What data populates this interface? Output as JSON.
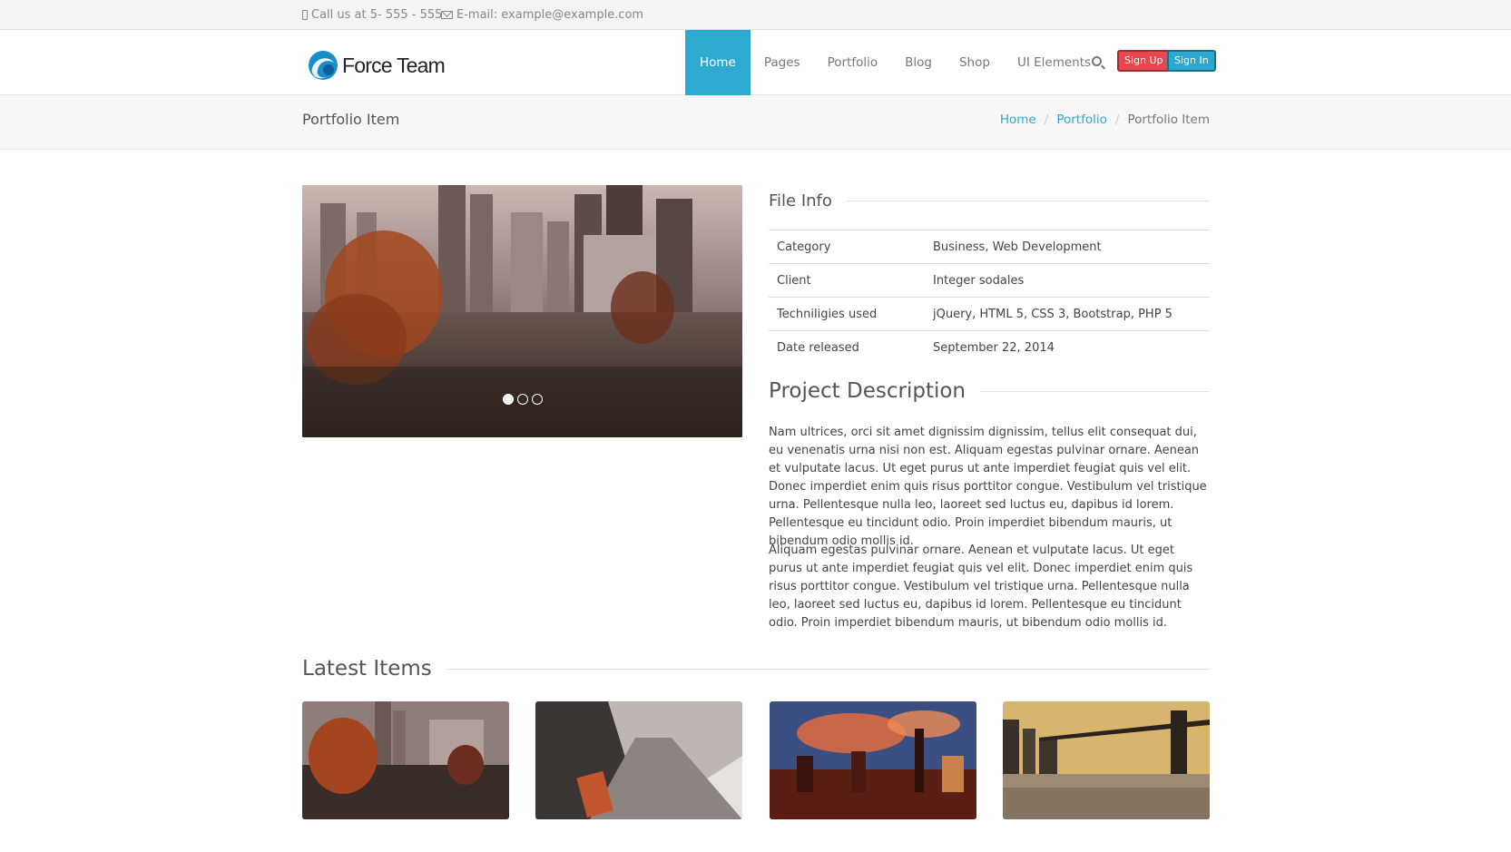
{
  "topbar": {
    "phone": "Call us at 5- 555 - 555",
    "email": "E-mail: example@example.com"
  },
  "header": {
    "logo_text": "Force Team",
    "nav": [
      "Home",
      "Pages",
      "Portfolio",
      "Blog",
      "Shop",
      "UI Elements"
    ],
    "active_nav": "Home",
    "signup_label": "Sign Up",
    "signin_label": "Sign In"
  },
  "crumbbar": {
    "title": "Portfolio Item",
    "breadcrumb": [
      "Home",
      "Portfolio",
      "Portfolio Item"
    ]
  },
  "slider": {
    "slide_count": 3,
    "active_slide": 1
  },
  "file_info": {
    "heading": "File Info",
    "rows": [
      {
        "key": "Category",
        "value": "Business, Web Development"
      },
      {
        "key": "Client",
        "value": "Integer sodales"
      },
      {
        "key": "Techniligies used",
        "value": "jQuery, HTML 5, CSS 3, Bootstrap, PHP 5"
      },
      {
        "key": "Date released",
        "value": "September 22, 2014"
      }
    ]
  },
  "project": {
    "heading": "Project Description",
    "paragraphs": [
      "Nam ultrices, orci sit amet dignissim dignissim, tellus elit consequat dui, eu venenatis urna nisi non est. Aliquam egestas pulvinar ornare. Aenean et vulputate lacus. Ut eget purus ut ante imperdiet feugiat quis vel elit. Donec imperdiet enim quis risus porttitor congue. Vestibulum vel tristique urna. Pellentesque nulla leo, laoreet sed luctus eu, dapibus id lorem. Pellentesque eu tincidunt odio. Proin imperdiet bibendum mauris, ut bibendum odio mollis id.",
      "Aliquam egestas pulvinar ornare. Aenean et vulputate lacus. Ut eget purus ut ante imperdiet feugiat quis vel elit. Donec imperdiet enim quis risus porttitor congue. Vestibulum vel tristique urna. Pellentesque nulla leo, laoreet sed luctus eu, dapibus id lorem. Pellentesque eu tincidunt odio. Proin imperdiet bibendum mauris, ut bibendum odio mollis id."
    ]
  },
  "latest": {
    "heading": "Latest Items"
  },
  "colors": {
    "accent": "#2eaad1",
    "signup": "#e8474f",
    "signin": "#2aa8d0"
  },
  "icons": [
    "mobile-phone-icon",
    "envelope-icon",
    "search-icon"
  ]
}
